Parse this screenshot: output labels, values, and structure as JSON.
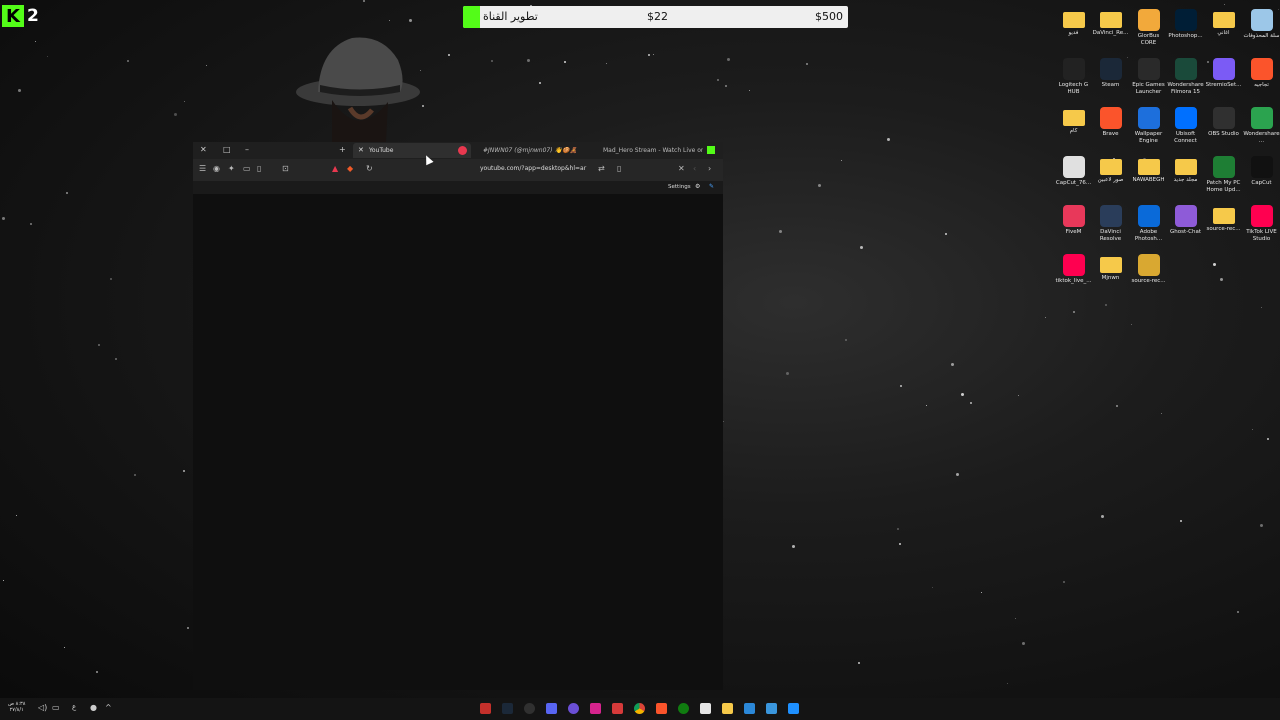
{
  "overlay": {
    "logo_letter": "K",
    "logo_number": "2",
    "goal": {
      "title": "تطوير القناة",
      "current": "$22",
      "target": "$500",
      "progress": 0.044
    }
  },
  "desktop_icons": [
    {
      "label": "فديو",
      "icon": "folder-icon"
    },
    {
      "label": "DaVinci_Re...",
      "icon": "folder-icon"
    },
    {
      "label": "GlorBus CORE",
      "icon": "app-icon"
    },
    {
      "label": "Photoshop...",
      "icon": "photoshop-icon"
    },
    {
      "label": "اغاني",
      "icon": "folder-icon"
    },
    {
      "label": "سلة المحذوفات",
      "icon": "recycle-bin-icon"
    },
    {
      "label": "Logitech G HUB",
      "icon": "logitech-icon"
    },
    {
      "label": "Steam",
      "icon": "steam-icon"
    },
    {
      "label": "Epic Games Launcher",
      "icon": "epic-icon"
    },
    {
      "label": "Wondershare Filmora 15",
      "icon": "filmora-icon"
    },
    {
      "label": "StremioSet...",
      "icon": "stremio-icon"
    },
    {
      "label": "تجاجيه",
      "icon": "brave-doc-icon"
    },
    {
      "label": "كام",
      "icon": "folder-icon"
    },
    {
      "label": "Brave",
      "icon": "brave-icon"
    },
    {
      "label": "Wallpaper Engine",
      "icon": "wallpaper-engine-icon"
    },
    {
      "label": "Ubisoft Connect",
      "icon": "ubisoft-icon"
    },
    {
      "label": "OBS Studio",
      "icon": "obs-icon"
    },
    {
      "label": "Wondershare...",
      "icon": "wondershare-icon"
    },
    {
      "label": "CapCut_76...",
      "icon": "capcut-setup-icon"
    },
    {
      "label": "صور لاعبين",
      "icon": "folder-icon"
    },
    {
      "label": "NAWABEGH",
      "icon": "folder-icon"
    },
    {
      "label": "مجلد جديد",
      "icon": "folder-icon"
    },
    {
      "label": "Patch My PC Home Upd...",
      "icon": "patch-icon"
    },
    {
      "label": "CapCut",
      "icon": "capcut-icon"
    },
    {
      "label": "FiveM",
      "icon": "fivem-icon"
    },
    {
      "label": "DaVinci Resolve",
      "icon": "davinci-icon"
    },
    {
      "label": "Adobe Photosh...",
      "icon": "download-icon"
    },
    {
      "label": "Ghost-Chat",
      "icon": "ghost-chat-icon"
    },
    {
      "label": "source-rec...",
      "icon": "folder-icon"
    },
    {
      "label": "TikTok LIVE Studio",
      "icon": "tiktok-icon"
    },
    {
      "label": "tiktok_live_...",
      "icon": "tiktok-icon"
    },
    {
      "label": "Mjnwn",
      "icon": "folder-icon"
    },
    {
      "label": "source-rec...",
      "icon": "archive-icon"
    }
  ],
  "browser": {
    "tabs": [
      {
        "label": "YouTube",
        "active": true
      },
      {
        "label": "#JNWN07 (@mjnwn07) 👋🍪🧸",
        "active": false
      },
      {
        "label": "Mad_Hero Stream - Watch Live on K",
        "active": false
      }
    ],
    "url": "youtube.com/?app=desktop&hl=ar",
    "settings_label": "Settings"
  },
  "taskbar": {
    "clock_time": "٨:٣٨ ص",
    "clock_date": "٢٧/٨/١"
  }
}
